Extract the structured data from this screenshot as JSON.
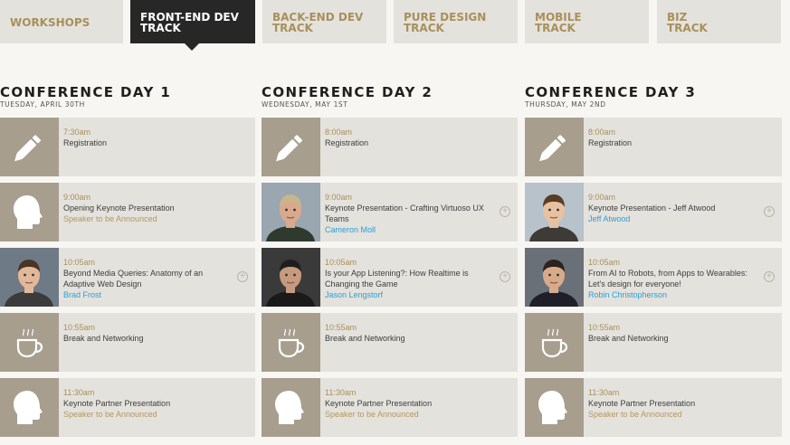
{
  "tabs": [
    {
      "line1": "WORKSHOPS",
      "line2": ""
    },
    {
      "line1": "FRONT-END DEV",
      "line2": "TRACK"
    },
    {
      "line1": "BACK-END DEV",
      "line2": "TRACK"
    },
    {
      "line1": "PURE DESIGN",
      "line2": "TRACK"
    },
    {
      "line1": "MOBILE",
      "line2": "TRACK"
    },
    {
      "line1": "BIZ",
      "line2": "TRACK"
    }
  ],
  "active_tab": 1,
  "colors": {
    "accent_gold": "#a8905a",
    "link_blue": "#2a9fd8",
    "tab_active": "#272727",
    "card_bg": "#e4e2dd",
    "thumb_bg": "#a79e8e"
  },
  "days": [
    {
      "title": "CONFERENCE DAY 1",
      "date": "TUESDAY, APRIL 30TH",
      "sessions": [
        {
          "icon": "pencil-icon",
          "time": "7:30am",
          "title": "Registration",
          "speaker": ""
        },
        {
          "icon": "head-silhouette-icon",
          "time": "9:00am",
          "title": "Opening Keynote Presentation",
          "speaker": "Speaker to be Announced",
          "speaker_tba": true
        },
        {
          "icon": "speaker-photo",
          "time": "10:05am",
          "title": "Beyond Media Queries: Anatomy of an Adaptive Web Design",
          "speaker": "Brad Frost",
          "has_more": true
        },
        {
          "icon": "coffee-cup-icon",
          "time": "10:55am",
          "title": "Break and Networking",
          "speaker": ""
        },
        {
          "icon": "head-silhouette-icon",
          "time": "11:30am",
          "title": "Keynote Partner Presentation",
          "speaker": "Speaker to be Announced",
          "speaker_tba": true
        }
      ]
    },
    {
      "title": "CONFERENCE DAY 2",
      "date": "WEDNESDAY, MAY 1ST",
      "sessions": [
        {
          "icon": "pencil-icon",
          "time": "8:00am",
          "title": "Registration",
          "speaker": ""
        },
        {
          "icon": "speaker-photo",
          "time": "9:00am",
          "title": "Keynote Presentation - Crafting Virtuoso UX Teams",
          "speaker": "Cameron Moll",
          "has_more": true
        },
        {
          "icon": "speaker-photo",
          "time": "10:05am",
          "title": "Is your App Listening?: How Realtime is Changing the Game",
          "speaker": "Jason Lengstorf",
          "has_more": true
        },
        {
          "icon": "coffee-cup-icon",
          "time": "10:55am",
          "title": "Break and Networking",
          "speaker": ""
        },
        {
          "icon": "head-silhouette-icon",
          "time": "11:30am",
          "title": "Keynote Partner Presentation",
          "speaker": "Speaker to be Announced",
          "speaker_tba": true
        }
      ]
    },
    {
      "title": "CONFERENCE DAY 3",
      "date": "THURSDAY, MAY 2ND",
      "sessions": [
        {
          "icon": "pencil-icon",
          "time": "8:00am",
          "title": "Registration",
          "speaker": ""
        },
        {
          "icon": "speaker-photo",
          "time": "9:00am",
          "title": "Keynote Presentation - Jeff Atwood",
          "speaker": "Jeff Atwood",
          "has_more": true
        },
        {
          "icon": "speaker-photo",
          "time": "10:05am",
          "title": "From AI to Robots, from Apps to Wearables: Let's design for everyone!",
          "speaker": "Robin Christopherson",
          "has_more": true
        },
        {
          "icon": "coffee-cup-icon",
          "time": "10:55am",
          "title": "Break and Networking",
          "speaker": ""
        },
        {
          "icon": "head-silhouette-icon",
          "time": "11:30am",
          "title": "Keynote Partner Presentation",
          "speaker": "Speaker to be Announced",
          "speaker_tba": true
        }
      ]
    }
  ]
}
